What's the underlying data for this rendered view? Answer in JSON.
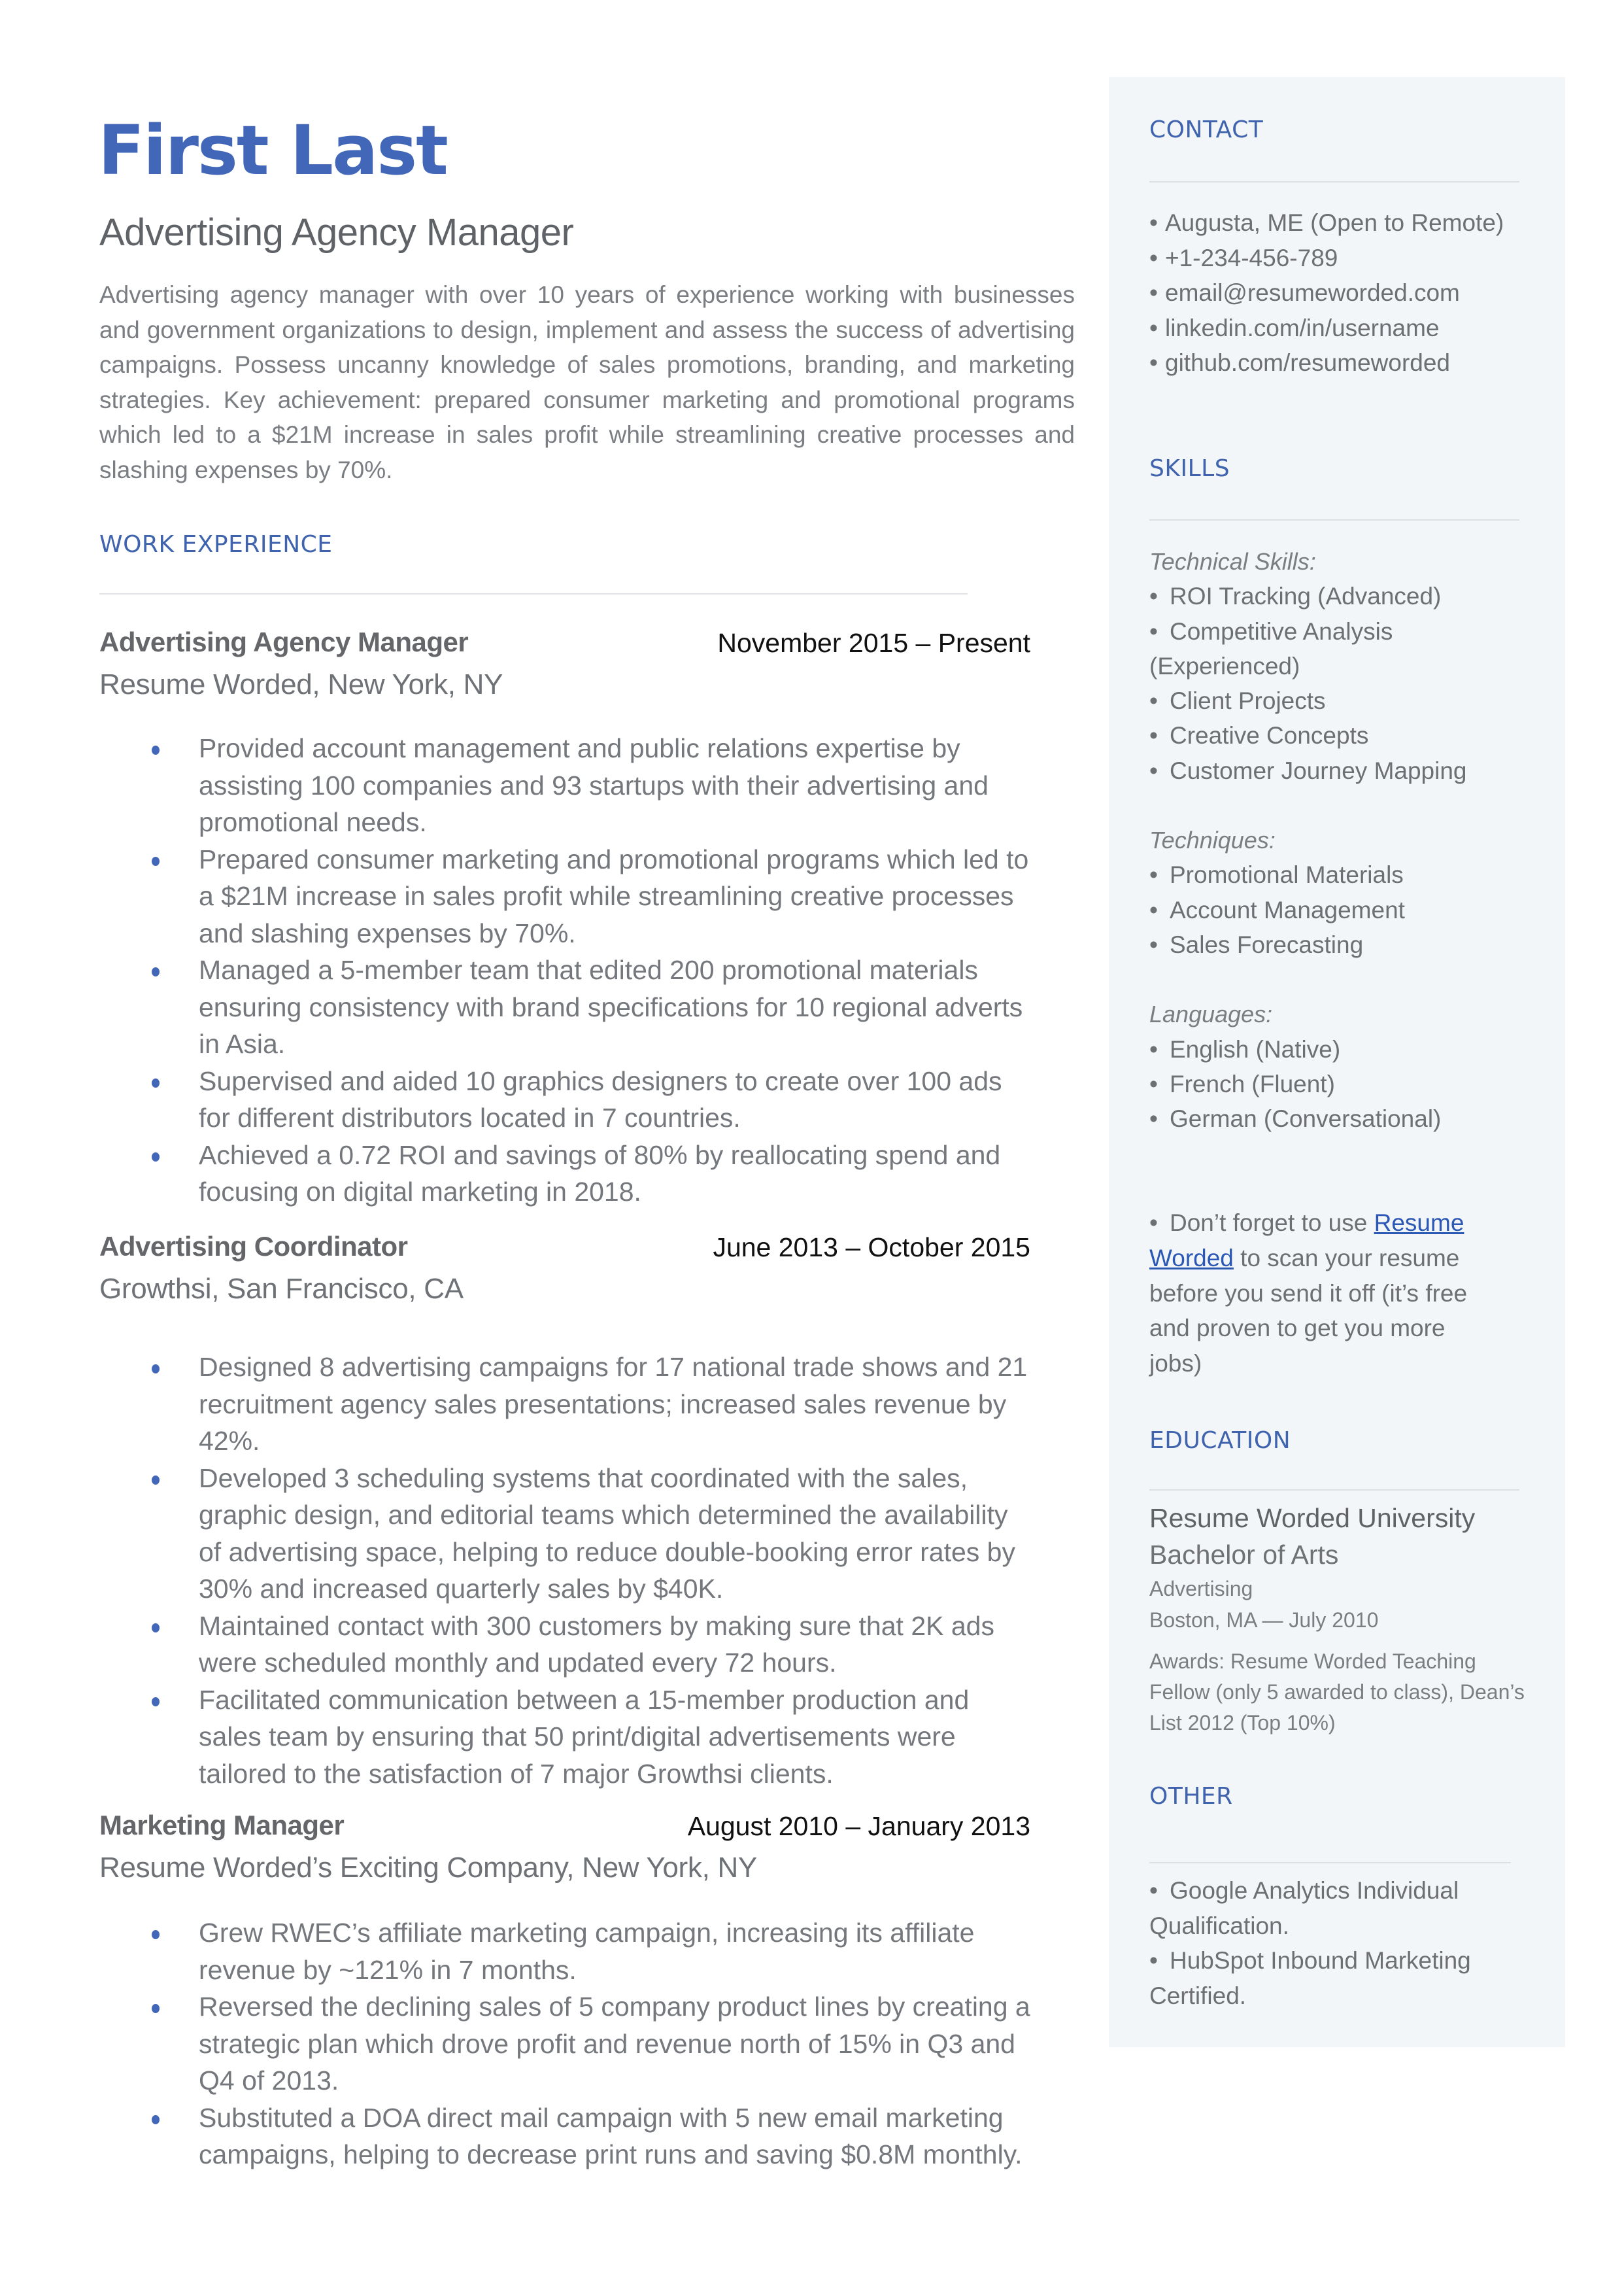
{
  "header": {
    "name": "First Last",
    "headline": "Advertising Agency Manager",
    "summary": "Advertising agency manager with over 10 years of experience working with businesses and government organizations to design, implement and assess the success of advertising campaigns. Possess uncanny knowledge of sales promotions, branding, and marketing strategies. Key achievement: prepared consumer marketing and promotional programs which led to a $21M increase in sales profit while streamlining creative processes and slashing expenses by 70%."
  },
  "colors": {
    "accent": "#4267b8",
    "section_title": "#3f63ad",
    "sidebar_bg": "#f3f6f9",
    "link": "#2b57b5"
  },
  "work": {
    "title": "WORK EXPERIENCE",
    "jobs": [
      {
        "title": "Advertising Agency Manager",
        "dates": "November 2015 – Present",
        "company": "Resume Worded, New York, NY",
        "bullets": [
          "Provided account management and public relations expertise by assisting 100 companies and 93 startups with their advertising and promotional needs.",
          "Prepared consumer marketing and promotional programs which led to a $21M increase in sales profit while streamlining creative processes and slashing expenses by 70%.",
          "Managed a 5-member team that edited 200 promotional materials ensuring consistency with brand specifications for 10 regional adverts in Asia.",
          "Supervised and aided 10 graphics designers to create over 100 ads for different distributors located in 7 countries.",
          "Achieved a 0.72 ROI and savings of 80% by reallocating spend and focusing on digital marketing in 2018."
        ]
      },
      {
        "title": "Advertising Coordinator",
        "dates": "June 2013 – October 2015",
        "company": "Growthsi, San Francisco, CA",
        "bullets": [
          "Designed 8 advertising campaigns for 17 national trade shows and 21 recruitment agency sales presentations; increased sales revenue by 42%.",
          "Developed 3 scheduling systems that coordinated with the sales, graphic design, and editorial teams which determined the availability of advertising space, helping to reduce double-booking error rates by 30% and increased quarterly sales by $40K.",
          "Maintained contact with 300 customers by making sure that 2K ads were scheduled monthly and updated every 72 hours.",
          "Facilitated communication between a 15-member production and sales team by ensuring that 50 print/digital advertisements were tailored to the satisfaction of 7 major Growthsi clients."
        ]
      },
      {
        "title": "Marketing Manager",
        "dates": "August 2010 – January 2013",
        "company": "Resume Worded’s Exciting Company, New York, NY",
        "bullets": [
          "Grew RWEC’s affiliate marketing campaign, increasing its affiliate revenue by ~121% in 7 months.",
          "Reversed the declining sales of 5 company product lines by creating a strategic plan which drove profit and revenue north of 15% in Q3 and Q4 of 2013.",
          "Substituted a DOA direct mail campaign with 5 new email marketing campaigns, helping to decrease print runs and saving $0.8M monthly."
        ]
      }
    ]
  },
  "sidebar": {
    "contact": {
      "title": "CONTACT",
      "bullet": "•",
      "items": [
        "Augusta, ME (Open to Remote)",
        "+1-234-456-789",
        "email@resumeworded.com",
        "linkedin.com/in/username",
        "github.com/resumeworded"
      ]
    },
    "skills": {
      "title": "SKILLS",
      "groups": [
        {
          "label": "Technical Skills:",
          "items": [
            "ROI Tracking (Advanced)",
            "Competitive Analysis (Experienced)",
            "Client Projects",
            "Creative Concepts",
            "Customer Journey Mapping"
          ]
        },
        {
          "label": "Techniques:",
          "items": [
            "Promotional Materials",
            "Account Management",
            "Sales Forecasting"
          ]
        },
        {
          "label": "Languages:",
          "items": [
            "English (Native)",
            "French (Fluent)",
            "German (Conversational)"
          ]
        }
      ],
      "tip": {
        "before": "Don’t forget to use ",
        "link": "Resume Worded",
        "after": " to scan your resume before you send it off (it’s free and proven to get you more jobs)"
      }
    },
    "education": {
      "title": "EDUCATION",
      "school": "Resume Worded University",
      "degree": "Bachelor of Arts",
      "field": "Advertising",
      "location_date": "Boston, MA — July 2010",
      "awards": "Awards: Resume Worded Teaching Fellow (only 5 awarded to class), Dean’s List 2012 (Top 10%)"
    },
    "other": {
      "title": "OTHER",
      "items": [
        "Google Analytics Individual Qualification.",
        "HubSpot Inbound Marketing Certified."
      ]
    }
  }
}
